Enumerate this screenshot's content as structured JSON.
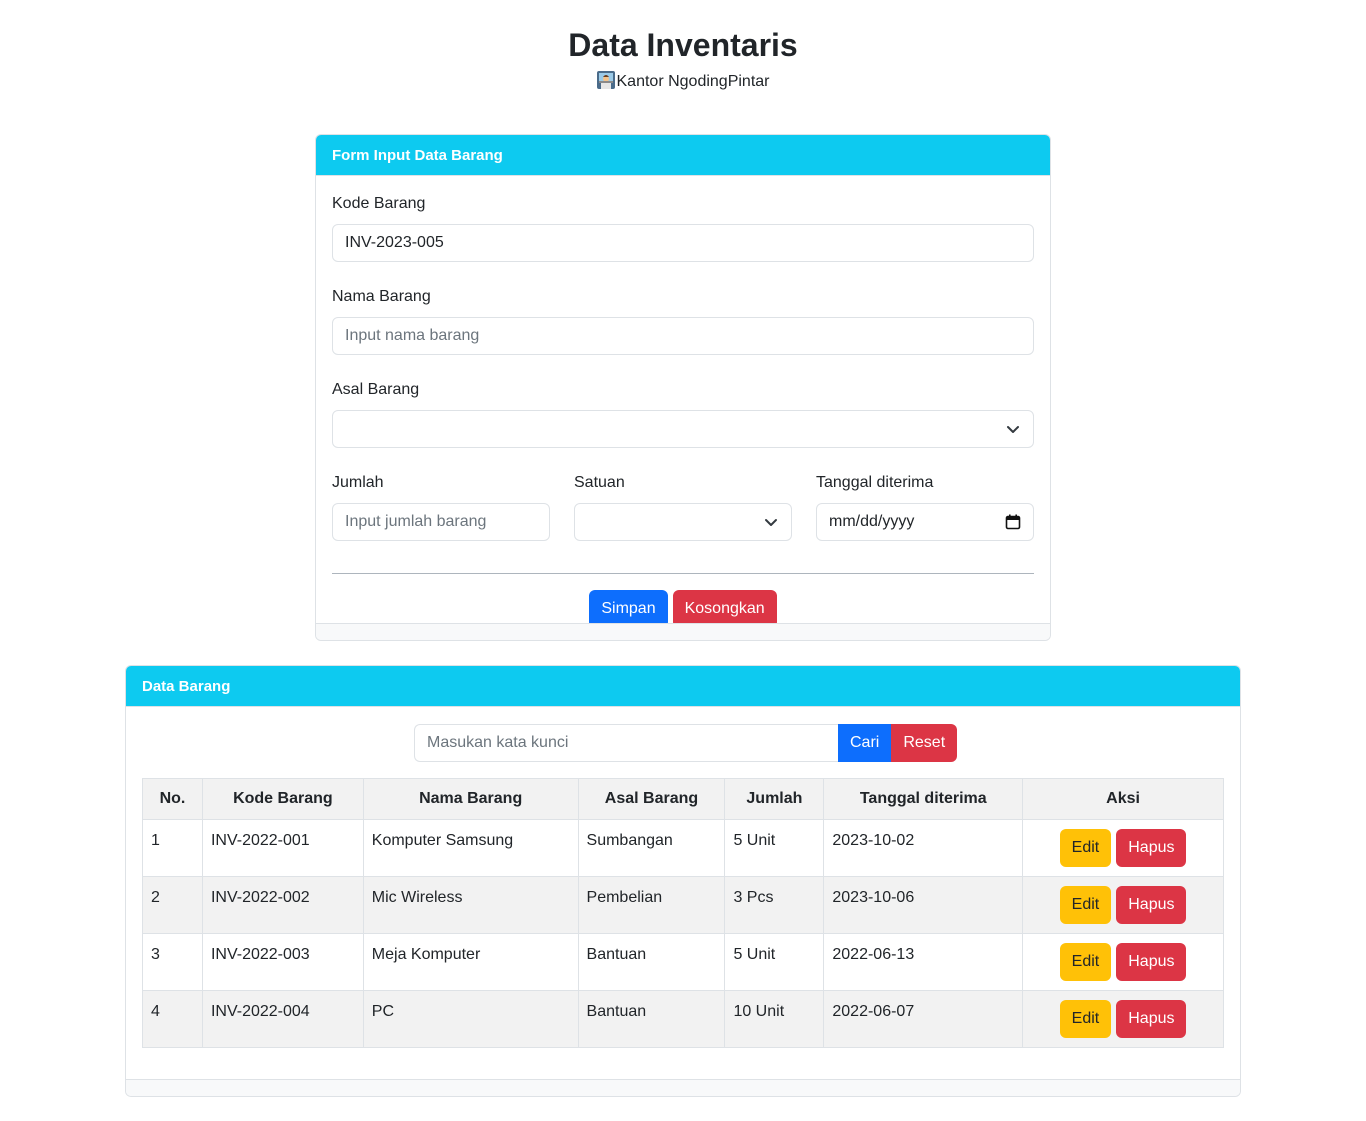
{
  "header": {
    "title": "Data Inventaris",
    "subtitle": "Kantor NgodingPintar"
  },
  "form": {
    "card_title": "Form Input Data Barang",
    "kode_label": "Kode Barang",
    "kode_value": "INV-2023-005",
    "nama_label": "Nama Barang",
    "nama_placeholder": "Input nama barang",
    "asal_label": "Asal Barang",
    "asal_value": "",
    "jumlah_label": "Jumlah",
    "jumlah_placeholder": "Input jumlah barang",
    "satuan_label": "Satuan",
    "satuan_value": "",
    "tanggal_label": "Tanggal diterima",
    "tanggal_placeholder": "mm/dd/yyyy",
    "save_label": "Simpan",
    "clear_label": "Kosongkan"
  },
  "table_section": {
    "card_title": "Data Barang",
    "search_placeholder": "Masukan kata kunci",
    "search_label": "Cari",
    "reset_label": "Reset",
    "columns": [
      "No.",
      "Kode Barang",
      "Nama Barang",
      "Asal Barang",
      "Jumlah",
      "Tanggal diterima",
      "Aksi"
    ],
    "edit_label": "Edit",
    "delete_label": "Hapus",
    "rows": [
      {
        "no": "1",
        "kode": "INV-2022-001",
        "nama": "Komputer Samsung",
        "asal": "Sumbangan",
        "jumlah": "5 Unit",
        "tanggal": "2023-10-02"
      },
      {
        "no": "2",
        "kode": "INV-2022-002",
        "nama": "Mic Wireless",
        "asal": "Pembelian",
        "jumlah": "3 Pcs",
        "tanggal": "2023-10-06"
      },
      {
        "no": "3",
        "kode": "INV-2022-003",
        "nama": "Meja Komputer",
        "asal": "Bantuan",
        "jumlah": "5 Unit",
        "tanggal": "2022-06-13"
      },
      {
        "no": "4",
        "kode": "INV-2022-004",
        "nama": "PC",
        "asal": "Bantuan",
        "jumlah": "10 Unit",
        "tanggal": "2022-06-07"
      }
    ]
  },
  "colors": {
    "header_bg": "#0dcaf0",
    "primary": "#0d6efd",
    "danger": "#dc3545",
    "warning": "#ffc107"
  },
  "icons": {
    "subtitle_icon": "office-worker-icon",
    "select_icon": "chevron-down-icon",
    "date_icon": "calendar-icon"
  }
}
